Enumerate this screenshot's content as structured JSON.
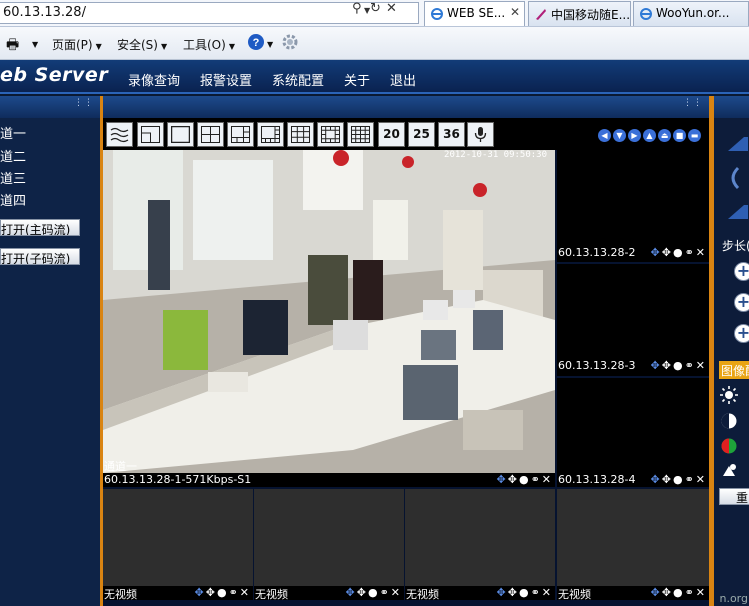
{
  "browser": {
    "url": "60.13.13.28/",
    "tabs": [
      {
        "label": "WEB SE...",
        "active": true
      },
      {
        "label": "中国移动随E...",
        "active": false
      },
      {
        "label": "WooYun.or...",
        "active": false
      }
    ],
    "command_bar": {
      "page_label": "页面(P)",
      "safety_label": "安全(S)",
      "tools_label": "工具(O)"
    }
  },
  "app": {
    "logo": "eb Server",
    "menu": [
      "录像查询",
      "报警设置",
      "系统配置",
      "关于",
      "退出"
    ]
  },
  "sidebar": {
    "channels": [
      "道一",
      "道二",
      "道三",
      "道四"
    ],
    "open_main": "打开(主码流)",
    "open_sub": "打开(子码流)"
  },
  "layout_buttons": [
    "20",
    "25",
    "36"
  ],
  "video": {
    "main": {
      "overlay_name": "通道一",
      "timestamp": "2012-10-31 09:50:30",
      "status": "60.13.13.28-1-571Kbps-S1"
    },
    "side": [
      {
        "status": "60.13.13.28-2"
      },
      {
        "status": "60.13.13.28-3"
      },
      {
        "status": "60.13.13.28-4"
      }
    ],
    "bottom": [
      {
        "status": "无视频"
      },
      {
        "status": "无视频"
      },
      {
        "status": "无视频"
      },
      {
        "status": "无视频"
      }
    ]
  },
  "right_panel": {
    "step_label": "步长(",
    "image_header": "图像配",
    "reset_label": "重"
  },
  "watermark": "n.org",
  "colors": {
    "accent_orange": "#d98412",
    "header_blue": "#0f2c5c",
    "ptz_blue": "#3b70d8"
  }
}
